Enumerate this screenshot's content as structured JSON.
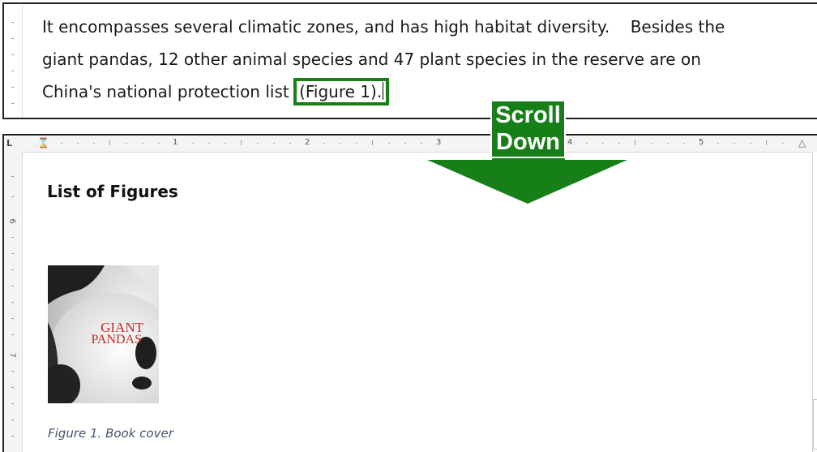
{
  "top_snippet": {
    "line1": "It encompasses several climatic zones, and has high habitat diversity.    Besides the",
    "line2": "giant pandas, 12 other animal species and 47 plant species in the reserve are on",
    "line3_prefix": "China's national protection list ",
    "figure_reference": "(Figure 1)."
  },
  "ruler": {
    "corner": "L",
    "numbers": [
      "1",
      "2",
      "3",
      "4",
      "5"
    ],
    "vertical_numbers": [
      "6",
      "7"
    ]
  },
  "document": {
    "section_title": "List of Figures",
    "book_cover_text_line1": "GIANT",
    "book_cover_text_line2": "PANDAS",
    "figure_caption": "Figure 1. Book cover"
  },
  "overlay": {
    "line1": "Scroll",
    "line2": "Down",
    "color": "#177f17"
  }
}
